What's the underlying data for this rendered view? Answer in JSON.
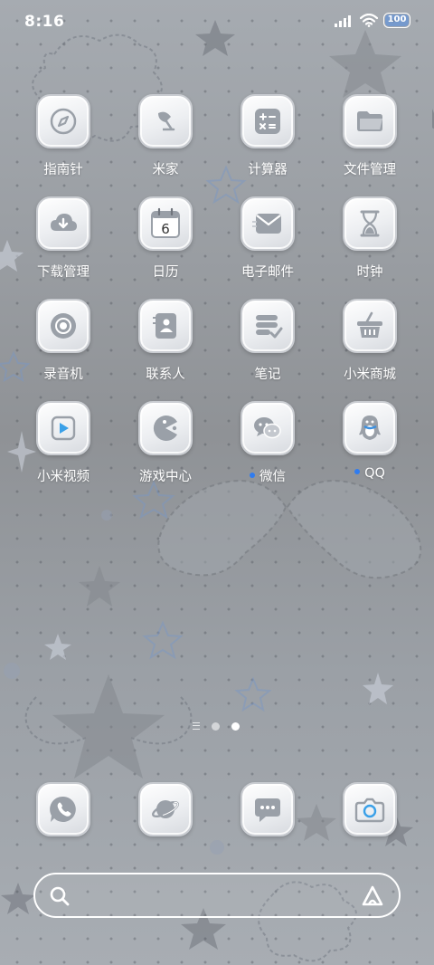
{
  "status": {
    "time": "8:16",
    "battery": "100",
    "signal_icon": "signal-icon",
    "wifi_icon": "wifi-icon"
  },
  "apps": [
    {
      "label": "指南针",
      "icon": "compass-icon"
    },
    {
      "label": "米家",
      "icon": "mijia-lamp-icon"
    },
    {
      "label": "计算器",
      "icon": "calculator-icon"
    },
    {
      "label": "文件管理",
      "icon": "folder-icon"
    },
    {
      "label": "下载管理",
      "icon": "download-icon"
    },
    {
      "label": "日历",
      "icon": "calendar-icon",
      "calendar_day": "6"
    },
    {
      "label": "电子邮件",
      "icon": "email-icon"
    },
    {
      "label": "时钟",
      "icon": "hourglass-icon"
    },
    {
      "label": "录音机",
      "icon": "recorder-icon"
    },
    {
      "label": "联系人",
      "icon": "contacts-icon"
    },
    {
      "label": "笔记",
      "icon": "notes-icon"
    },
    {
      "label": "小米商城",
      "icon": "shopping-basket-icon"
    },
    {
      "label": "小米视频",
      "icon": "video-play-icon"
    },
    {
      "label": "游戏中心",
      "icon": "game-pacman-icon"
    },
    {
      "label": "微信",
      "icon": "wechat-icon",
      "new_dot": true
    },
    {
      "label": "QQ",
      "icon": "qq-penguin-icon",
      "new_dot": true
    }
  ],
  "dock": [
    {
      "icon": "phone-icon"
    },
    {
      "icon": "browser-planet-icon"
    },
    {
      "icon": "messages-icon"
    },
    {
      "icon": "camera-icon"
    }
  ],
  "page_indicator": {
    "pages": 2,
    "current": 2
  },
  "colors": {
    "icon_stroke": "#9aa0a8",
    "badge": "#2f7cf0",
    "calendar_red": "#e05a4a"
  }
}
